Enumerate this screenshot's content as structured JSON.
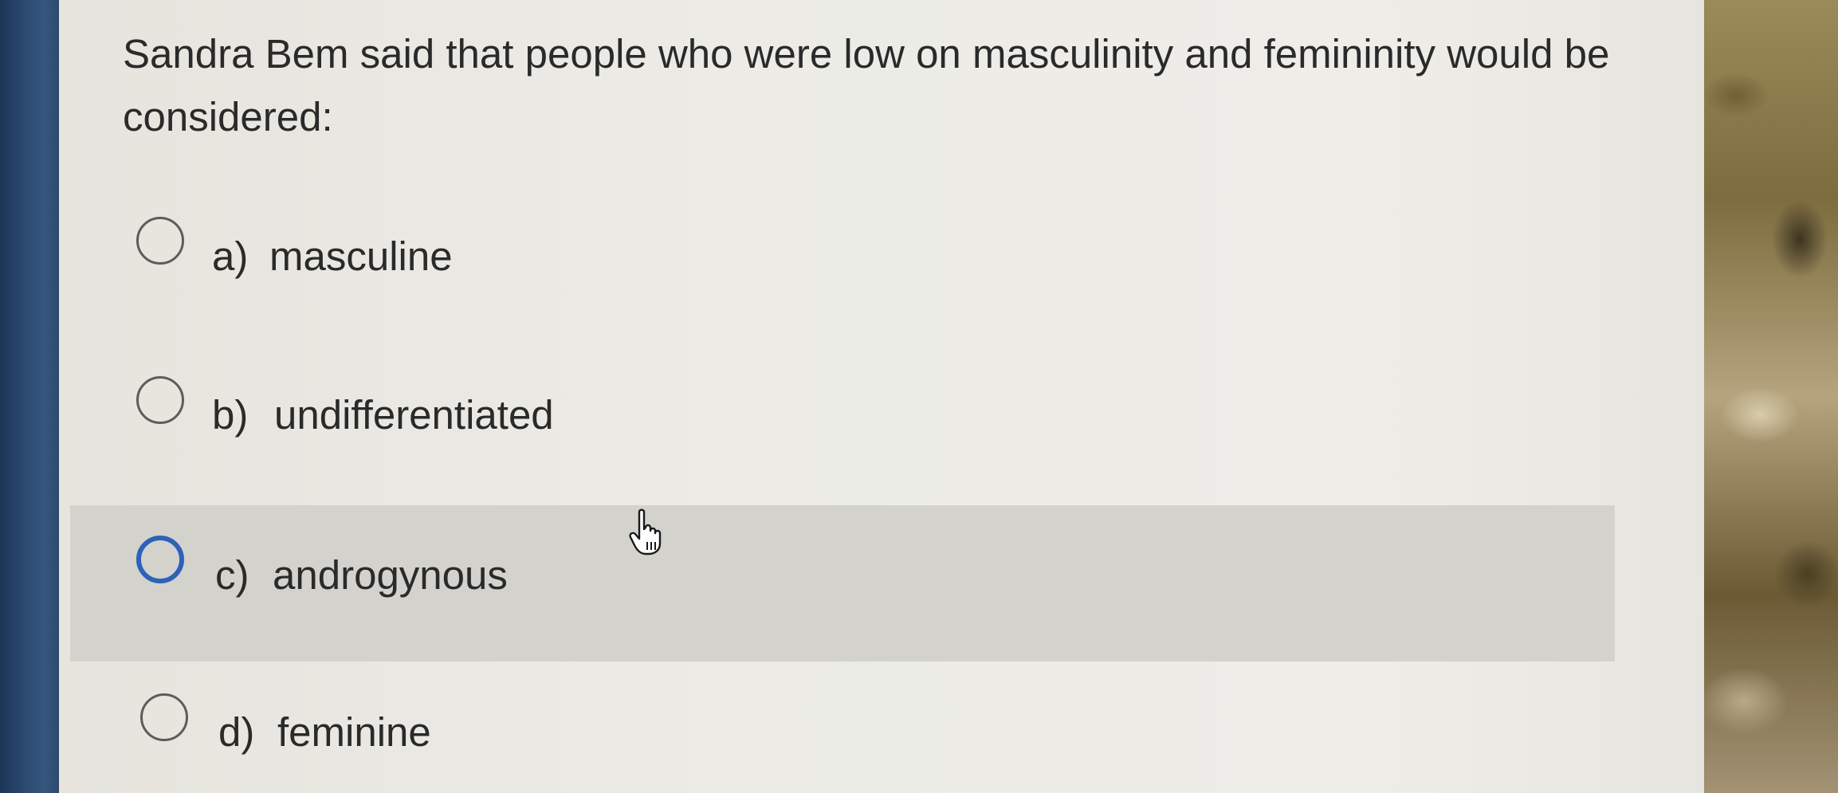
{
  "question": {
    "text": "Sandra Bem said that people who were low on masculinity and femininity would be considered:"
  },
  "options": [
    {
      "letter": "a)",
      "text": "masculine",
      "selected": false
    },
    {
      "letter": "b)",
      "text": "undifferentiated",
      "selected": false
    },
    {
      "letter": "c)",
      "text": "androgynous",
      "selected": false,
      "hovered": true
    },
    {
      "letter": "d)",
      "text": "feminine",
      "selected": false
    }
  ],
  "colors": {
    "panel": "#ecebe6",
    "hover_row": "#d3d2cc",
    "focus_radio": "#2d62b8",
    "text": "#2a2a2a"
  },
  "icons": {
    "cursor": "hand-pointer-icon"
  }
}
